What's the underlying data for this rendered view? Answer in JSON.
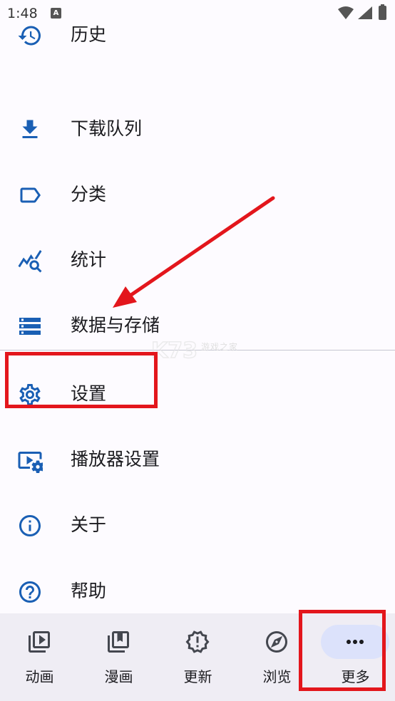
{
  "status_bar": {
    "time": "1:48",
    "notif_glyph": "A"
  },
  "menu": {
    "items": [
      {
        "id": "history",
        "label": "历史",
        "icon": "history-icon"
      },
      {
        "id": "download-queue",
        "label": "下载队列",
        "icon": "download-icon"
      },
      {
        "id": "categories",
        "label": "分类",
        "icon": "label-icon"
      },
      {
        "id": "stats",
        "label": "统计",
        "icon": "query-stats-icon"
      },
      {
        "id": "data-storage",
        "label": "数据与存储",
        "icon": "storage-icon"
      },
      {
        "id": "settings",
        "label": "设置",
        "icon": "gear-icon"
      },
      {
        "id": "player-settings",
        "label": "播放器设置",
        "icon": "video-settings-icon"
      },
      {
        "id": "about",
        "label": "关于",
        "icon": "info-icon"
      },
      {
        "id": "help",
        "label": "帮助",
        "icon": "help-icon"
      }
    ]
  },
  "bottom_nav": {
    "items": [
      {
        "id": "anime",
        "label": "动画",
        "icon": "video-library-icon",
        "active": false
      },
      {
        "id": "manga",
        "label": "漫画",
        "icon": "book-library-icon",
        "active": false
      },
      {
        "id": "updates",
        "label": "更新",
        "icon": "new-releases-icon",
        "active": false
      },
      {
        "id": "browse",
        "label": "浏览",
        "icon": "compass-icon",
        "active": false
      },
      {
        "id": "more",
        "label": "更多",
        "icon": "more-horiz-icon",
        "active": true
      }
    ]
  },
  "watermark": {
    "text": "游戏之家"
  },
  "colors": {
    "background": "#fdfbff",
    "icon_blue": "#1a5fb4",
    "nav_background": "#efedf4",
    "active_pill": "#dce2fb",
    "annotation_red": "#e3161c",
    "divider": "#c5c6d0"
  }
}
